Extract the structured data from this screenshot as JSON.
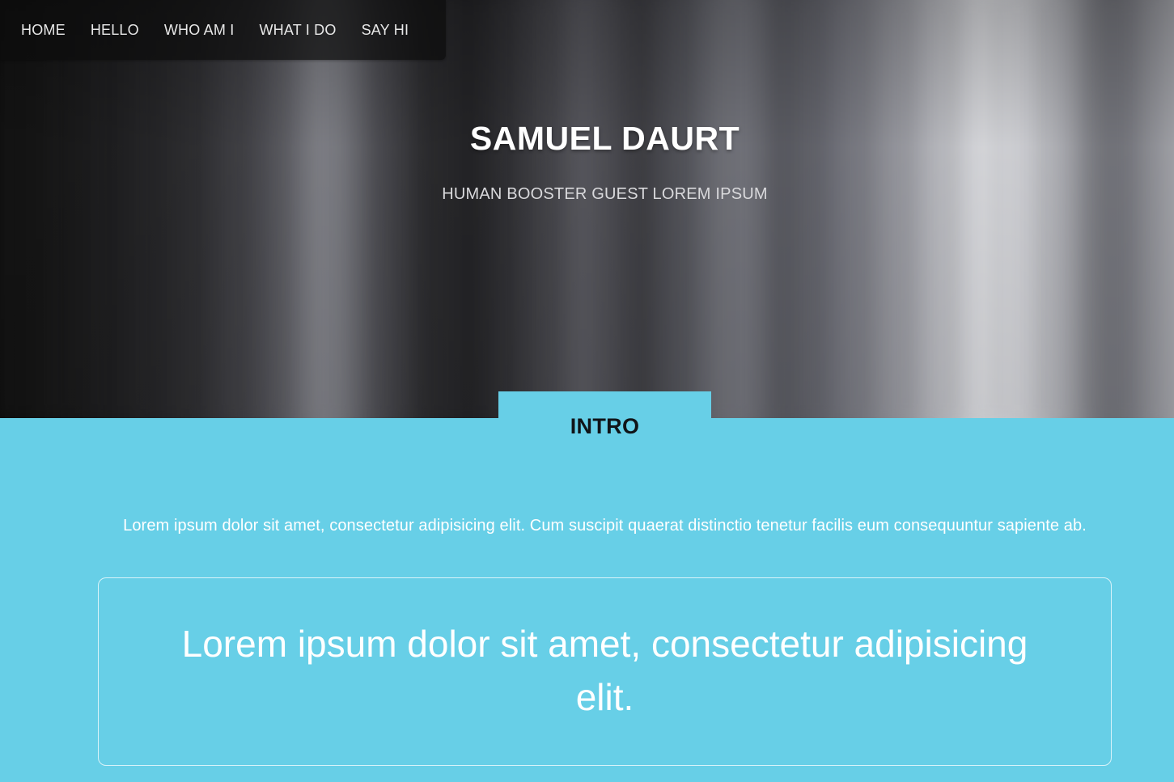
{
  "nav": {
    "items": [
      {
        "label": "HOME"
      },
      {
        "label": "HELLO"
      },
      {
        "label": "WHO AM I"
      },
      {
        "label": "WHAT I DO"
      },
      {
        "label": "SAY HI"
      }
    ]
  },
  "hero": {
    "title": "SAMUEL DAURT",
    "subtitle": "HUMAN BOOSTER GUEST LOREM IPSUM"
  },
  "intro": {
    "tab_label": "INTRO",
    "paragraph": "Lorem ipsum dolor sit amet, consectetur adipisicing elit. Cum suscipit quaerat distinctio tenetur facilis eum consequuntur sapiente ab.",
    "quote": "Lorem ipsum dolor sit amet, consectetur adipisicing elit."
  },
  "colors": {
    "accent": "#67cfe7",
    "nav_background": "#0c0c0c",
    "text_light": "#ffffff",
    "tab_text": "#101418"
  }
}
